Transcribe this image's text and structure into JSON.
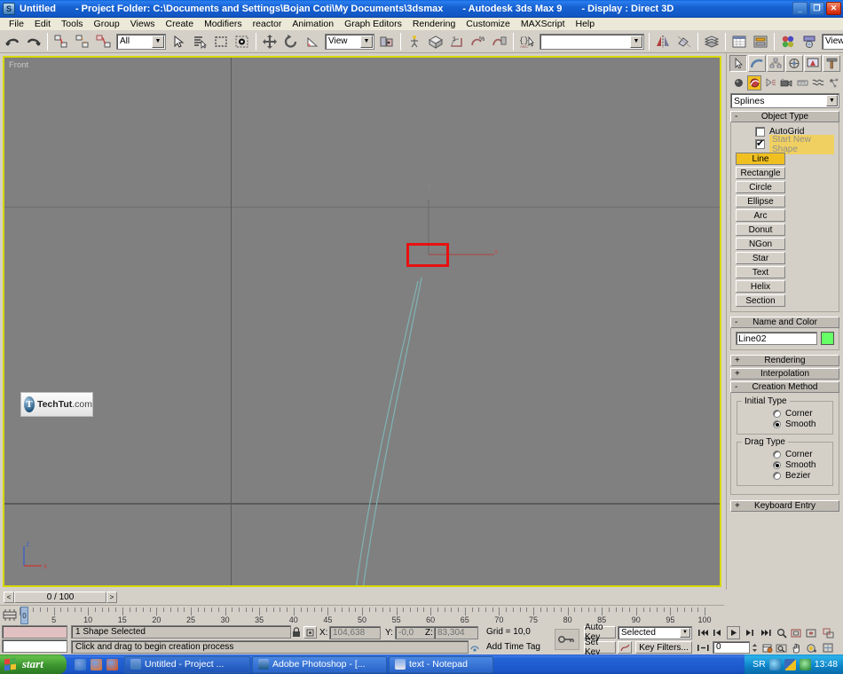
{
  "titlebar": {
    "icon": "max-app-icon",
    "doc": "Untitled",
    "project": "- Project Folder: C:\\Documents and Settings\\Bojan Coti\\My Documents\\3dsmax",
    "app": "- Autodesk 3ds Max 9",
    "display": "- Display : Direct 3D",
    "minimize": "_",
    "maximize": "❐",
    "close": "✕"
  },
  "menubar": {
    "items": [
      "File",
      "Edit",
      "Tools",
      "Group",
      "Views",
      "Create",
      "Modifiers",
      "reactor",
      "Animation",
      "Graph Editors",
      "Rendering",
      "Customize",
      "MAXScript",
      "Help"
    ]
  },
  "toolbar": {
    "undo": "undo-icon",
    "redo": "redo-icon",
    "select_link": "select-and-link-icon",
    "unlink": "unlink-selection-icon",
    "bind_space_warp": "bind-to-space-warp-icon",
    "selection_filter": "All",
    "select_object": "select-object-icon",
    "select_by_name": "select-by-name-icon",
    "select_region": "rectangular-selection-region-icon",
    "window_crossing": "window-crossing-icon",
    "select_move": "select-and-move-icon",
    "select_rotate": "select-and-rotate-icon",
    "select_scale": "select-and-uniform-scale-icon",
    "ref_coord_system": "View",
    "use_pivot": "use-pivot-point-center-icon",
    "select_manipulate": "select-and-manipulate-icon",
    "snaps_toggle": "3d-snap-toggle-icon",
    "angle_snap": "angle-snap-toggle-icon",
    "percent_snap": "percent-snap-toggle-icon",
    "spinner_snap": "spinner-snap-toggle-icon",
    "named_sets": "edit-named-selection-sets-icon",
    "named_set_value": "",
    "mirror": "mirror-icon",
    "align": "align-icon",
    "layer_manager": "layer-manager-icon",
    "curve_editor": "curve-editor-icon",
    "schematic_view": "schematic-view-icon",
    "material_editor": "material-editor-icon",
    "render_scene": "render-scene-dialog-icon",
    "render_type": "View"
  },
  "viewport": {
    "label": "Front",
    "axis_x": "x",
    "axis_y": "y",
    "axis_z": "z",
    "gizmo_z": "z",
    "gizmo_x": "x",
    "logo_mark": "T",
    "logo_name": "TechTut",
    "logo_tld": ".com",
    "spline_color": "#7fb3b3",
    "selection_color": "#e81010",
    "border_color": "#d8d800"
  },
  "command_panel": {
    "tabs": [
      {
        "name": "create-tab",
        "icon": "arrow-cursor-icon",
        "active": true
      },
      {
        "name": "modify-tab",
        "icon": "bent-tube-icon",
        "active": false
      },
      {
        "name": "hierarchy-tab",
        "icon": "hierarchy-icon",
        "active": false
      },
      {
        "name": "motion-tab",
        "icon": "wheel-icon",
        "active": false
      },
      {
        "name": "display-tab",
        "icon": "monitor-icon",
        "active": false
      },
      {
        "name": "utilities-tab",
        "icon": "hammer-icon",
        "active": false
      }
    ],
    "subtabs": [
      {
        "name": "geometry-button",
        "icon": "sphere-icon",
        "active": false
      },
      {
        "name": "shapes-button",
        "icon": "shapes-icon",
        "active": true
      },
      {
        "name": "lights-button",
        "icon": "light-icon",
        "active": false
      },
      {
        "name": "cameras-button",
        "icon": "camera-icon",
        "active": false
      },
      {
        "name": "helpers-button",
        "icon": "tape-icon",
        "active": false
      },
      {
        "name": "space-warps-button",
        "icon": "space-warp-icon",
        "active": false
      },
      {
        "name": "systems-button",
        "icon": "systems-icon",
        "active": false
      }
    ],
    "category": "Splines",
    "object_type": {
      "title": "Object Type",
      "sign": "-",
      "autogrid_label": "AutoGrid",
      "autogrid_checked": false,
      "start_new_shape_label": "Start New Shape",
      "start_new_shape_checked": true,
      "buttons": [
        {
          "label": "Line",
          "active": true
        },
        {
          "label": "Rectangle",
          "active": false
        },
        {
          "label": "Circle",
          "active": false
        },
        {
          "label": "Ellipse",
          "active": false
        },
        {
          "label": "Arc",
          "active": false
        },
        {
          "label": "Donut",
          "active": false
        },
        {
          "label": "NGon",
          "active": false
        },
        {
          "label": "Star",
          "active": false
        },
        {
          "label": "Text",
          "active": false
        },
        {
          "label": "Helix",
          "active": false
        },
        {
          "label": "Section",
          "active": false
        }
      ]
    },
    "name_and_color": {
      "title": "Name and Color",
      "sign": "-",
      "name": "Line02",
      "color": "#66ff66"
    },
    "rollouts": [
      {
        "title": "Rendering",
        "sign": "+"
      },
      {
        "title": "Interpolation",
        "sign": "+"
      }
    ],
    "creation_method": {
      "title": "Creation Method",
      "sign": "-",
      "initial_type": {
        "legend": "Initial Type",
        "options": [
          {
            "label": "Corner",
            "selected": false
          },
          {
            "label": "Smooth",
            "selected": true
          }
        ]
      },
      "drag_type": {
        "legend": "Drag Type",
        "options": [
          {
            "label": "Corner",
            "selected": false
          },
          {
            "label": "Smooth",
            "selected": true
          },
          {
            "label": "Bezier",
            "selected": false
          }
        ]
      }
    },
    "keyboard_entry": {
      "title": "Keyboard Entry",
      "sign": "+"
    }
  },
  "time_slider": {
    "prev_arrow": "<",
    "next_arrow": ">",
    "current": "0 / 100",
    "handle_label": "0"
  },
  "track_bar": {
    "open_mini_curve_editor": "open-mini-curve-editor-icon",
    "tick_labels": [
      "5",
      "10",
      "15",
      "20",
      "25",
      "30",
      "35",
      "40",
      "45",
      "50",
      "55",
      "60",
      "65",
      "70",
      "75",
      "80",
      "85",
      "90",
      "95",
      "100"
    ],
    "range_start": 0,
    "range_end": 100
  },
  "status_bar": {
    "status_text": "1 Shape Selected",
    "prompt_text": "Click and drag to begin creation process",
    "lock_selection": "lock-selection-icon",
    "absolute_mode": "absolute-relative-transform-toggle-icon",
    "x_label": "X:",
    "x_value": "104,638",
    "y_label": "Y:",
    "y_value": "-0,0",
    "z_label": "Z:",
    "z_value": "83,304",
    "grid_text": "Grid = 10,0",
    "add_time_tag": "Add Time Tag",
    "time_tag_icon": "time-tag-icon",
    "adaptive_degradation": "adaptive-degradation-toggle-icon",
    "auto_key": "Auto Key",
    "set_key": "Set Key",
    "key_mode_icon": "set-key-filters-icon",
    "selection_set": "Selected",
    "key_filters": "Key Filters...",
    "frame_value": "0"
  },
  "animation_controls": {
    "go_to_start": "go-to-start-icon",
    "previous_frame": "previous-frame-icon",
    "play": "play-animation-icon",
    "next_frame": "next-frame-icon",
    "go_to_end": "go-to-end-icon",
    "key_mode_toggle": "key-mode-toggle-icon",
    "time_configuration": "time-configuration-icon"
  },
  "viewport_nav": {
    "zoom": "zoom-icon",
    "zoom_all": "zoom-all-icon",
    "zoom_extents": "zoom-extents-icon",
    "zoom_extents_all": "zoom-extents-all-icon",
    "field_of_view": "field-of-view-icon",
    "pan": "pan-view-icon",
    "arc_rotate": "arc-rotate-icon",
    "maximize_viewport": "maximize-viewport-toggle-icon"
  },
  "taskbar": {
    "start_label": "start",
    "quick_launch": [
      {
        "name": "internet-explorer-icon",
        "color": "#2a6fc0"
      },
      {
        "name": "media-player-icon",
        "color": "#e87020"
      },
      {
        "name": "firefox-icon",
        "color": "#e05010"
      }
    ],
    "tasks": [
      {
        "label": "Untitled        - Project ...",
        "icon": "max-app-icon",
        "icon_color": "#3a78b8",
        "active": true
      },
      {
        "label": "Adobe Photoshop - [...",
        "icon": "photoshop-icon",
        "icon_color": "#1a5a8a",
        "active": false
      },
      {
        "label": "text - Notepad",
        "icon": "notepad-icon",
        "icon_color": "#e8e8f0",
        "active": false
      }
    ],
    "tray": {
      "language": "SR",
      "icons": [
        {
          "name": "volume-icon",
          "color": "#2a7fc8"
        },
        {
          "name": "security-alert-icon",
          "color": "#f0c020"
        },
        {
          "name": "antivirus-icon",
          "color": "#2aa84a"
        }
      ],
      "clock": "13:48"
    }
  }
}
